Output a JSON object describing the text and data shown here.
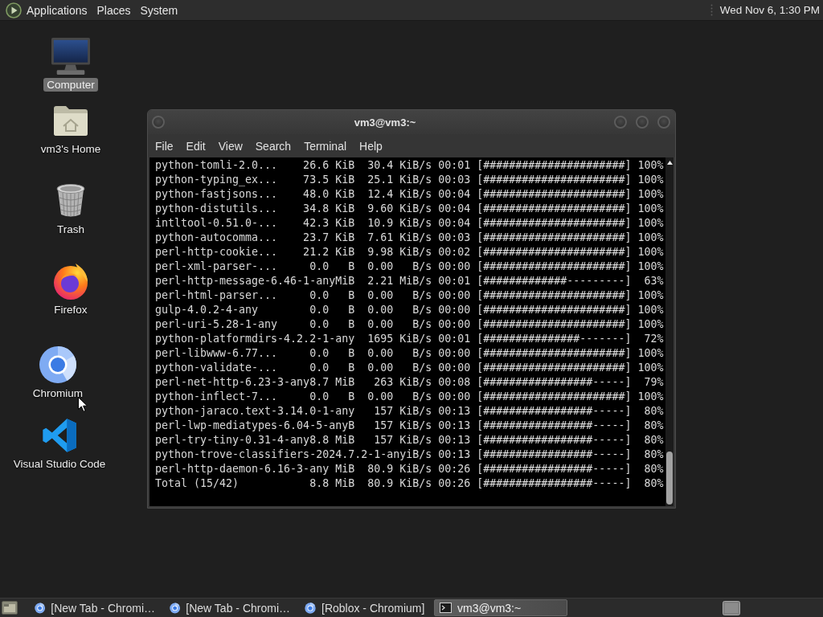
{
  "top_panel": {
    "menus": [
      "Applications",
      "Places",
      "System"
    ],
    "clock": "Wed Nov 6, 1:30 PM"
  },
  "desktop_icons": [
    {
      "kind": "computer",
      "label": "Computer",
      "selected": true
    },
    {
      "kind": "home",
      "label": "vm3's Home",
      "selected": false
    },
    {
      "kind": "trash",
      "label": "Trash",
      "selected": false
    },
    {
      "kind": "firefox",
      "label": "Firefox",
      "selected": false
    },
    {
      "kind": "chromium",
      "label": "Chromium",
      "selected": false
    },
    {
      "kind": "vscode",
      "label": "Visual Studio Code",
      "selected": false
    }
  ],
  "terminal_window": {
    "title": "vm3@vm3:~",
    "menus": [
      "File",
      "Edit",
      "View",
      "Search",
      "Terminal",
      "Help"
    ],
    "lines": [
      "python-tomli-2.0...    26.6 KiB  30.4 KiB/s 00:01 [######################] 100%",
      "python-typing_ex...    73.5 KiB  25.1 KiB/s 00:03 [######################] 100%",
      "python-fastjsons...    48.0 KiB  12.4 KiB/s 00:04 [######################] 100%",
      "python-distutils...    34.8 KiB  9.60 KiB/s 00:04 [######################] 100%",
      "intltool-0.51.0-...    42.3 KiB  10.9 KiB/s 00:04 [######################] 100%",
      "python-autocomma...    23.7 KiB  7.61 KiB/s 00:03 [######################] 100%",
      "perl-http-cookie...    21.2 KiB  9.98 KiB/s 00:02 [######################] 100%",
      "perl-xml-parser-...     0.0   B  0.00   B/s 00:00 [######################] 100%",
      "perl-http-message-6.46-1-anyMiB  2.21 MiB/s 00:01 [#############---------]  63%",
      "perl-html-parser...     0.0   B  0.00   B/s 00:00 [######################] 100%",
      "gulp-4.0.2-4-any        0.0   B  0.00   B/s 00:00 [######################] 100%",
      "perl-uri-5.28-1-any     0.0   B  0.00   B/s 00:00 [######################] 100%",
      "python-platformdirs-4.2.2-1-any  1695 KiB/s 00:01 [###############-------]  72%",
      "perl-libwww-6.77...     0.0   B  0.00   B/s 00:00 [######################] 100%",
      "python-validate-...     0.0   B  0.00   B/s 00:00 [######################] 100%",
      "perl-net-http-6.23-3-any8.7 MiB   263 KiB/s 00:08 [#################-----]  79%",
      "python-inflect-7...     0.0   B  0.00   B/s 00:00 [######################] 100%",
      "python-jaraco.text-3.14.0-1-any   157 KiB/s 00:13 [#################-----]  80%",
      "perl-lwp-mediatypes-6.04-5-anyB   157 KiB/s 00:13 [#################-----]  80%",
      "perl-try-tiny-0.31-4-any8.8 MiB   157 KiB/s 00:13 [#################-----]  80%",
      "python-trove-classifiers-2024.7.2-1-anyiB/s 00:13 [#################-----]  80%",
      "perl-http-daemon-6.16-3-any MiB  80.9 KiB/s 00:26 [#################-----]  80%",
      "Total (15/42)           8.8 MiB  80.9 KiB/s 00:26 [#################-----]  80%"
    ]
  },
  "taskbar": {
    "tasks": [
      {
        "kind": "browser",
        "label": "[New Tab - Chromi…",
        "selected": false
      },
      {
        "kind": "browser",
        "label": "[New Tab - Chromi…",
        "selected": false
      },
      {
        "kind": "browser",
        "label": "[Roblox - Chromium]",
        "selected": false
      },
      {
        "kind": "terminal",
        "label": "vm3@vm3:~",
        "selected": true
      }
    ]
  }
}
